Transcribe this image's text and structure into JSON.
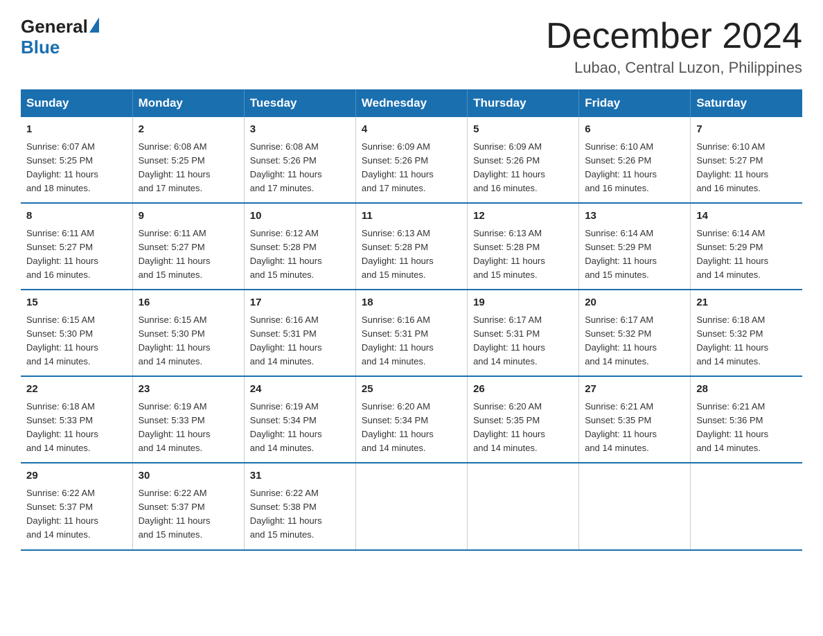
{
  "header": {
    "logo_general": "General",
    "logo_blue": "Blue",
    "month_title": "December 2024",
    "location": "Lubao, Central Luzon, Philippines"
  },
  "weekdays": [
    "Sunday",
    "Monday",
    "Tuesday",
    "Wednesday",
    "Thursday",
    "Friday",
    "Saturday"
  ],
  "weeks": [
    [
      {
        "day": "1",
        "sunrise": "6:07 AM",
        "sunset": "5:25 PM",
        "daylight": "11 hours and 18 minutes."
      },
      {
        "day": "2",
        "sunrise": "6:08 AM",
        "sunset": "5:25 PM",
        "daylight": "11 hours and 17 minutes."
      },
      {
        "day": "3",
        "sunrise": "6:08 AM",
        "sunset": "5:26 PM",
        "daylight": "11 hours and 17 minutes."
      },
      {
        "day": "4",
        "sunrise": "6:09 AM",
        "sunset": "5:26 PM",
        "daylight": "11 hours and 17 minutes."
      },
      {
        "day": "5",
        "sunrise": "6:09 AM",
        "sunset": "5:26 PM",
        "daylight": "11 hours and 16 minutes."
      },
      {
        "day": "6",
        "sunrise": "6:10 AM",
        "sunset": "5:26 PM",
        "daylight": "11 hours and 16 minutes."
      },
      {
        "day": "7",
        "sunrise": "6:10 AM",
        "sunset": "5:27 PM",
        "daylight": "11 hours and 16 minutes."
      }
    ],
    [
      {
        "day": "8",
        "sunrise": "6:11 AM",
        "sunset": "5:27 PM",
        "daylight": "11 hours and 16 minutes."
      },
      {
        "day": "9",
        "sunrise": "6:11 AM",
        "sunset": "5:27 PM",
        "daylight": "11 hours and 15 minutes."
      },
      {
        "day": "10",
        "sunrise": "6:12 AM",
        "sunset": "5:28 PM",
        "daylight": "11 hours and 15 minutes."
      },
      {
        "day": "11",
        "sunrise": "6:13 AM",
        "sunset": "5:28 PM",
        "daylight": "11 hours and 15 minutes."
      },
      {
        "day": "12",
        "sunrise": "6:13 AM",
        "sunset": "5:28 PM",
        "daylight": "11 hours and 15 minutes."
      },
      {
        "day": "13",
        "sunrise": "6:14 AM",
        "sunset": "5:29 PM",
        "daylight": "11 hours and 15 minutes."
      },
      {
        "day": "14",
        "sunrise": "6:14 AM",
        "sunset": "5:29 PM",
        "daylight": "11 hours and 14 minutes."
      }
    ],
    [
      {
        "day": "15",
        "sunrise": "6:15 AM",
        "sunset": "5:30 PM",
        "daylight": "11 hours and 14 minutes."
      },
      {
        "day": "16",
        "sunrise": "6:15 AM",
        "sunset": "5:30 PM",
        "daylight": "11 hours and 14 minutes."
      },
      {
        "day": "17",
        "sunrise": "6:16 AM",
        "sunset": "5:31 PM",
        "daylight": "11 hours and 14 minutes."
      },
      {
        "day": "18",
        "sunrise": "6:16 AM",
        "sunset": "5:31 PM",
        "daylight": "11 hours and 14 minutes."
      },
      {
        "day": "19",
        "sunrise": "6:17 AM",
        "sunset": "5:31 PM",
        "daylight": "11 hours and 14 minutes."
      },
      {
        "day": "20",
        "sunrise": "6:17 AM",
        "sunset": "5:32 PM",
        "daylight": "11 hours and 14 minutes."
      },
      {
        "day": "21",
        "sunrise": "6:18 AM",
        "sunset": "5:32 PM",
        "daylight": "11 hours and 14 minutes."
      }
    ],
    [
      {
        "day": "22",
        "sunrise": "6:18 AM",
        "sunset": "5:33 PM",
        "daylight": "11 hours and 14 minutes."
      },
      {
        "day": "23",
        "sunrise": "6:19 AM",
        "sunset": "5:33 PM",
        "daylight": "11 hours and 14 minutes."
      },
      {
        "day": "24",
        "sunrise": "6:19 AM",
        "sunset": "5:34 PM",
        "daylight": "11 hours and 14 minutes."
      },
      {
        "day": "25",
        "sunrise": "6:20 AM",
        "sunset": "5:34 PM",
        "daylight": "11 hours and 14 minutes."
      },
      {
        "day": "26",
        "sunrise": "6:20 AM",
        "sunset": "5:35 PM",
        "daylight": "11 hours and 14 minutes."
      },
      {
        "day": "27",
        "sunrise": "6:21 AM",
        "sunset": "5:35 PM",
        "daylight": "11 hours and 14 minutes."
      },
      {
        "day": "28",
        "sunrise": "6:21 AM",
        "sunset": "5:36 PM",
        "daylight": "11 hours and 14 minutes."
      }
    ],
    [
      {
        "day": "29",
        "sunrise": "6:22 AM",
        "sunset": "5:37 PM",
        "daylight": "11 hours and 14 minutes."
      },
      {
        "day": "30",
        "sunrise": "6:22 AM",
        "sunset": "5:37 PM",
        "daylight": "11 hours and 15 minutes."
      },
      {
        "day": "31",
        "sunrise": "6:22 AM",
        "sunset": "5:38 PM",
        "daylight": "11 hours and 15 minutes."
      },
      null,
      null,
      null,
      null
    ]
  ],
  "labels": {
    "sunrise": "Sunrise:",
    "sunset": "Sunset:",
    "daylight": "Daylight:"
  }
}
